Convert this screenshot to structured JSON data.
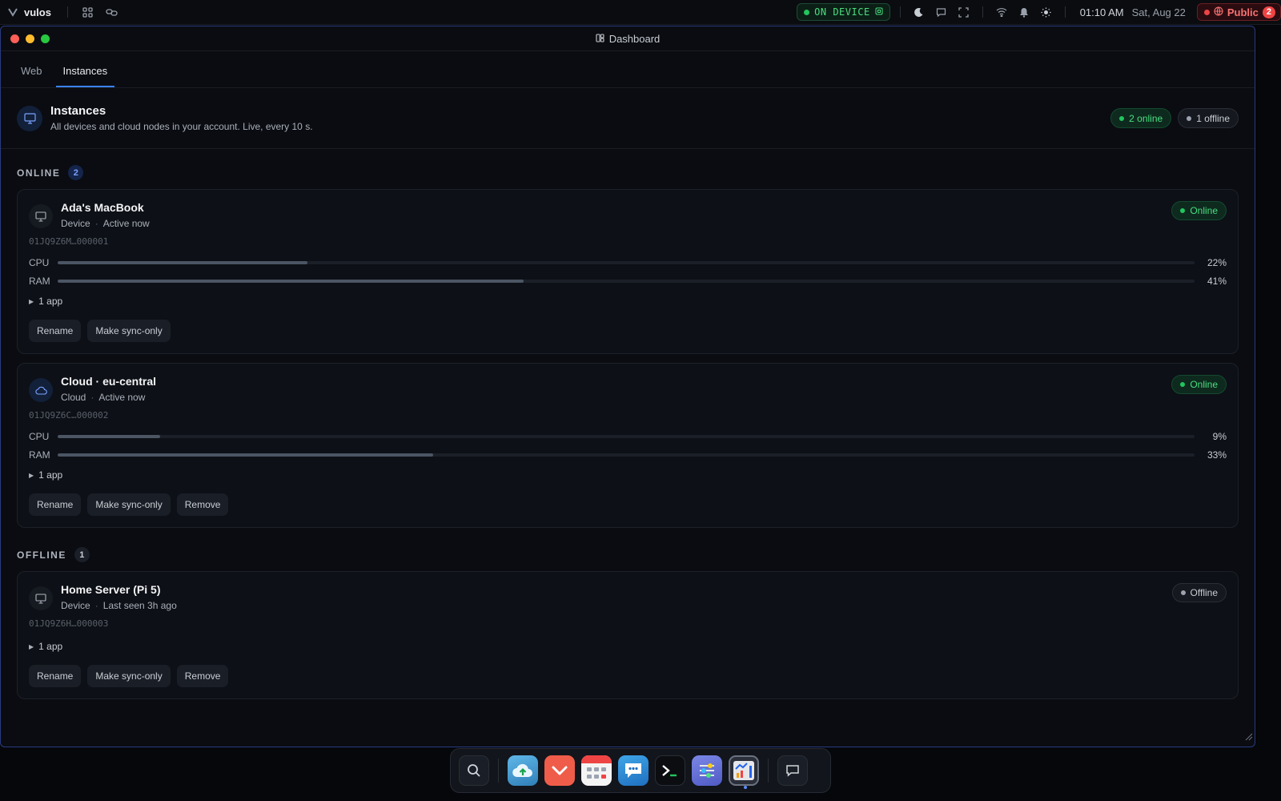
{
  "topbar": {
    "brand": "vulos",
    "on_device": "ON DEVICE",
    "time": "01:10 AM",
    "date": "Sat, Aug 22",
    "public_label": "Public",
    "public_count": "2",
    "colors": {
      "ok": "#4ade80",
      "alert": "#ef4444"
    }
  },
  "window": {
    "title": "Dashboard",
    "tabs": [
      {
        "label": "Web",
        "active": false
      },
      {
        "label": "Instances",
        "active": true
      }
    ]
  },
  "header": {
    "title": "Instances",
    "subtitle": "All devices and cloud nodes in your account. Live, every 10 s.",
    "online_pill": "2 online",
    "offline_pill": "1 offline"
  },
  "sections": {
    "online": {
      "label": "ONLINE",
      "count": "2"
    },
    "offline": {
      "label": "OFFLINE",
      "count": "1"
    }
  },
  "labels": {
    "cpu": "CPU",
    "ram": "RAM",
    "separator": "·"
  },
  "instances": [
    {
      "name": "Ada's MacBook",
      "kind": "Device",
      "activity": "Active now",
      "id": "01JQ9Z6M…000001",
      "status": "Online",
      "cpu": "22%",
      "cpu_value": 0.22,
      "ram": "41%",
      "ram_value": 0.41,
      "apps": "1 app",
      "actions": [
        "Rename",
        "Make sync-only"
      ]
    },
    {
      "name": "Cloud · eu-central",
      "kind": "Cloud",
      "activity": "Active now",
      "id": "01JQ9Z6C…000002",
      "status": "Online",
      "cpu": "9%",
      "cpu_value": 0.09,
      "ram": "33%",
      "ram_value": 0.33,
      "apps": "1 app",
      "actions": [
        "Rename",
        "Make sync-only",
        "Remove"
      ]
    },
    {
      "name": "Home Server (Pi 5)",
      "kind": "Device",
      "activity": "Last seen 3h ago",
      "id": "01JQ9Z6H…000003",
      "status": "Offline",
      "apps": "1 app",
      "actions": [
        "Rename",
        "Make sync-only",
        "Remove"
      ]
    }
  ],
  "dock": {
    "items": [
      "search-icon",
      "cloud-upload-icon",
      "pocket-icon",
      "calendar-icon",
      "chat-icon",
      "terminal-icon",
      "settings-sliders-icon",
      "dashboard-chart-icon",
      "message-icon"
    ]
  }
}
